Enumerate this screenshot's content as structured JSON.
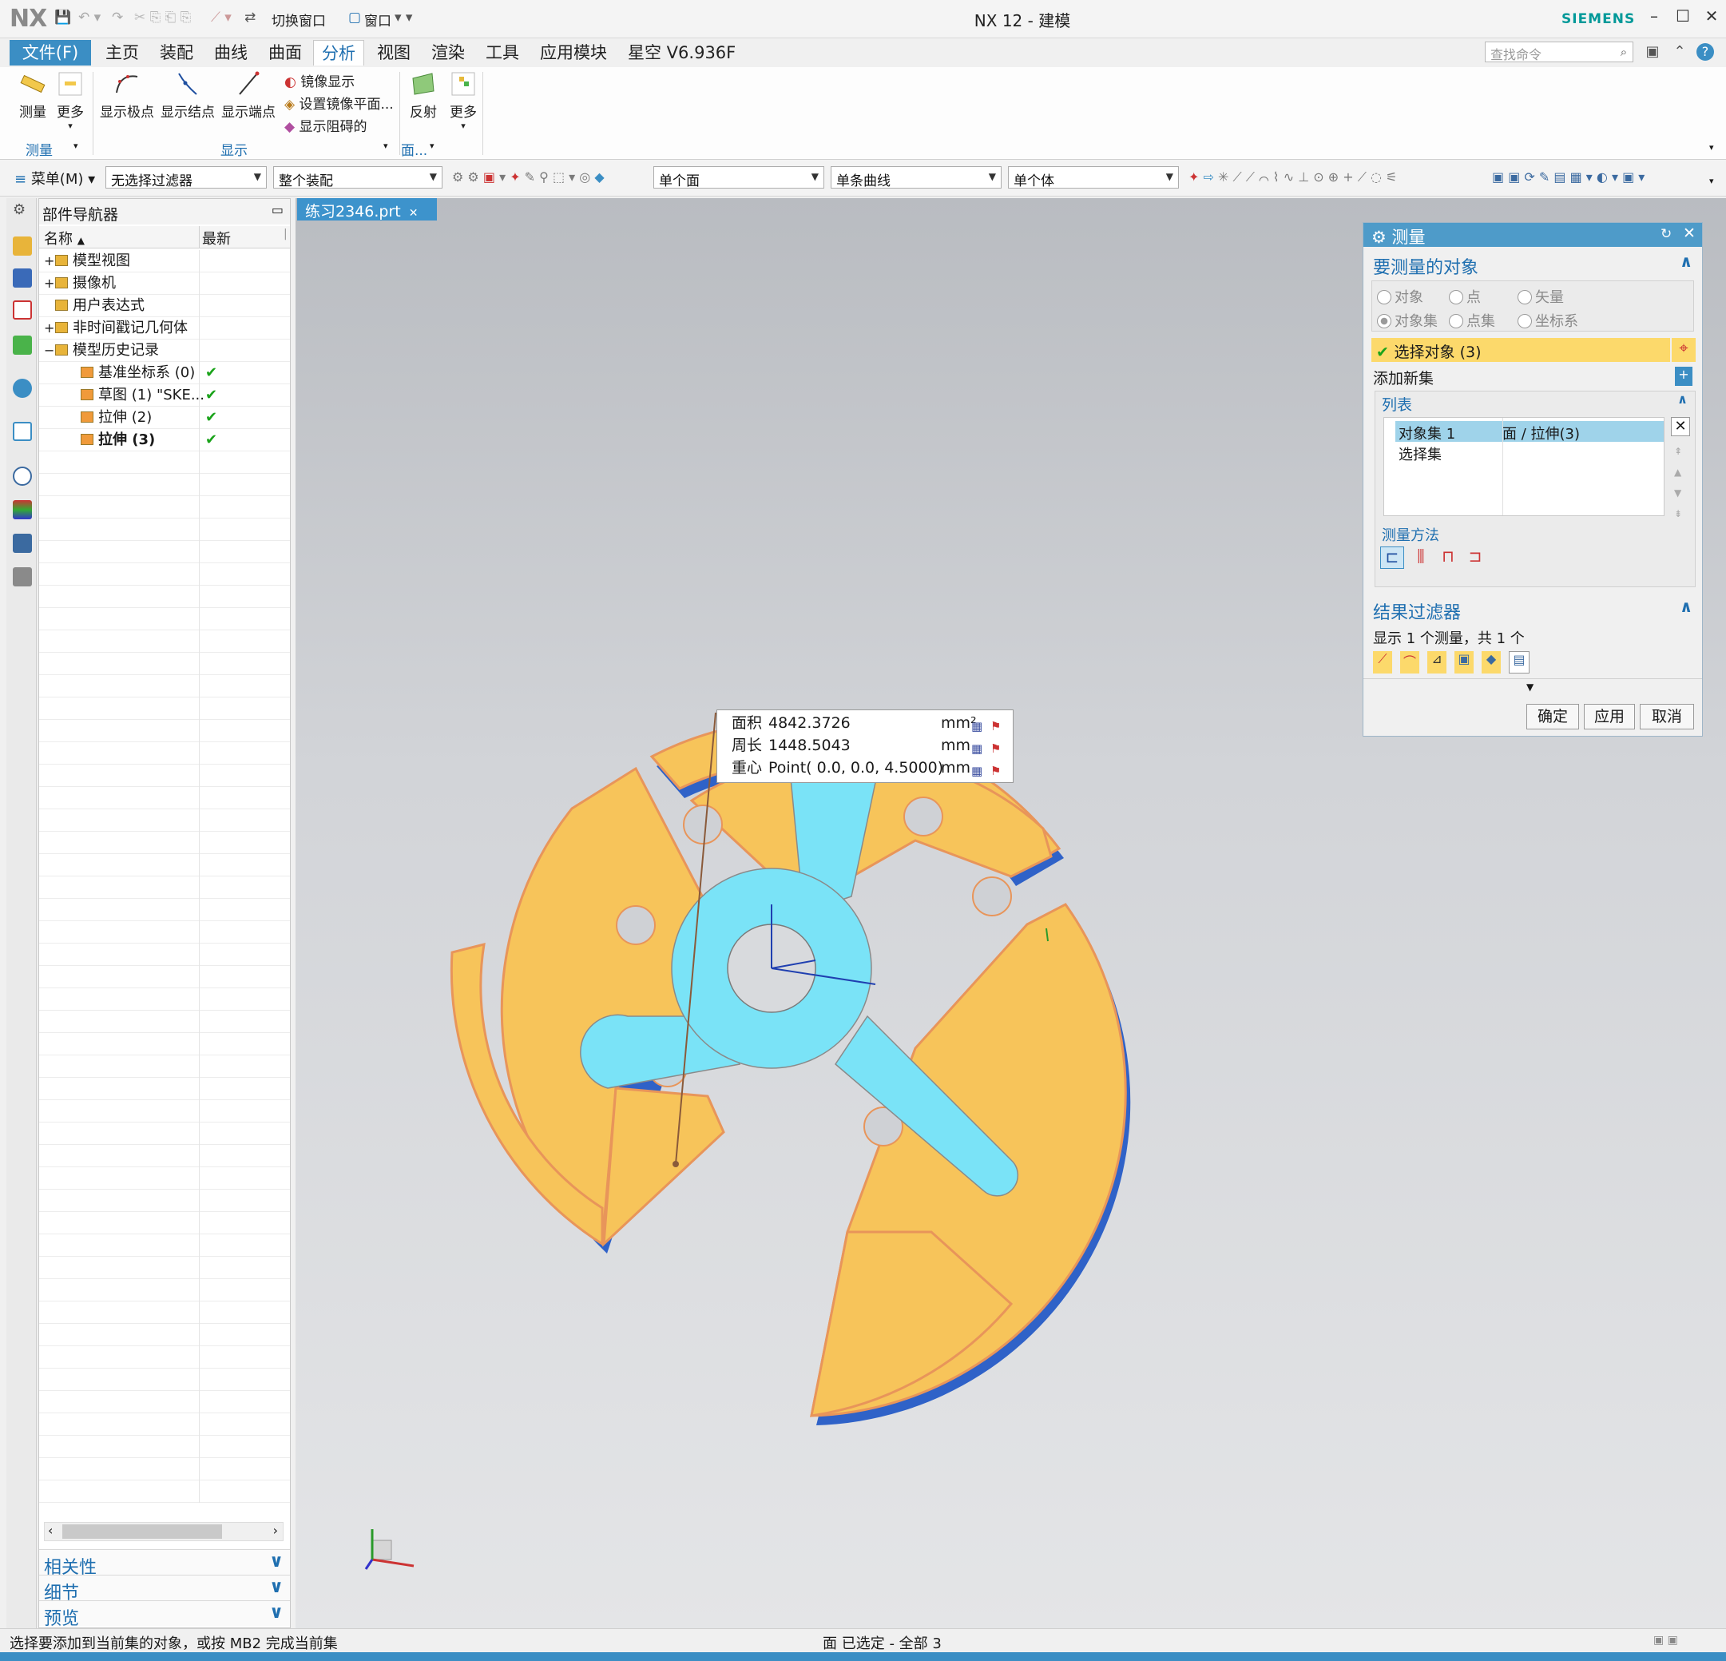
{
  "titlebar": {
    "logo": "NX",
    "switch_window": "切换窗口",
    "window_menu": "窗口",
    "title": "NX 12 - 建模",
    "brand": "SIEMENS"
  },
  "menubar": {
    "file": "文件(F)",
    "tabs": [
      "主页",
      "装配",
      "曲线",
      "曲面",
      "分析",
      "视图",
      "渲染",
      "工具",
      "应用模块",
      "星空 V6.936F"
    ],
    "active_tab": "分析",
    "search_placeholder": "查找命令"
  },
  "ribbon": {
    "measure": "测量",
    "more": "更多",
    "show_poles": "显示极点",
    "show_knots": "显示结点",
    "show_endpoints": "显示端点",
    "mirror_display": "镜像显示",
    "set_mirror_plane": "设置镜像平面...",
    "show_blocked": "显示阻碍的",
    "reflection": "反射",
    "more2": "更多",
    "group_measure": "测量",
    "group_display": "显示",
    "group_face": "面..."
  },
  "toolbar2": {
    "menu": "菜单(M)",
    "filter": "无选择过滤器",
    "assembly": "整个装配",
    "face_rule": "单个面",
    "curve_rule": "单条曲线",
    "body_rule": "单个体"
  },
  "navigator": {
    "title": "部件导航器",
    "col_name": "名称",
    "col_latest": "最新",
    "items": [
      {
        "label": "模型视图",
        "level": 0,
        "expander": "+"
      },
      {
        "label": "摄像机",
        "level": 0,
        "expander": "+"
      },
      {
        "label": "用户表达式",
        "level": 0,
        "expander": ""
      },
      {
        "label": "非时间戳记几何体",
        "level": 0,
        "expander": "+"
      },
      {
        "label": "模型历史记录",
        "level": 0,
        "expander": "−"
      },
      {
        "label": "基准坐标系 (0)",
        "level": 1,
        "latest": "✔"
      },
      {
        "label": "草图 (1) \"SKE...",
        "level": 1,
        "latest": "✔"
      },
      {
        "label": "拉伸 (2)",
        "level": 1,
        "latest": "✔"
      },
      {
        "label": "拉伸 (3)",
        "level": 1,
        "latest": "✔"
      }
    ],
    "panels": [
      "相关性",
      "细节",
      "预览"
    ]
  },
  "doc_tab": "练习2346.prt",
  "measure_dialog": {
    "title": "测量",
    "section_objects": "要测量的对象",
    "radios": [
      "对象",
      "点",
      "矢量",
      "对象集",
      "点集",
      "坐标系"
    ],
    "select_objects": "选择对象 (3)",
    "add_new_set": "添加新集",
    "list_title": "列表",
    "list_rows": [
      {
        "c1": "对象集 1",
        "c2": "面 / 拉伸(3)"
      },
      {
        "c1": "选择集",
        "c2": ""
      }
    ],
    "method_title": "测量方法",
    "result_filter": "结果过滤器",
    "show_count": "显示 1 个测量，共 1 个",
    "ok": "确定",
    "apply": "应用",
    "cancel": "取消"
  },
  "measurement": {
    "rows": [
      {
        "label": "面积",
        "value": "4842.3726",
        "unit": "mm²"
      },
      {
        "label": "周长",
        "value": "1448.5043",
        "unit": "mm"
      },
      {
        "label": "重心",
        "value": "Point( 0.0, 0.0, 4.5000)",
        "unit": "mm"
      }
    ]
  },
  "status": {
    "prompt": "选择要添加到当前集的对象，或按 MB2 完成当前集",
    "selection": "面 已选定 - 全部 3"
  },
  "colors": {
    "accent": "#3b8ec4",
    "part_orange": "#f7c45a",
    "part_edge": "#e8955a",
    "part_blue": "#7ae3f7",
    "part_side": "#2f62c8"
  }
}
